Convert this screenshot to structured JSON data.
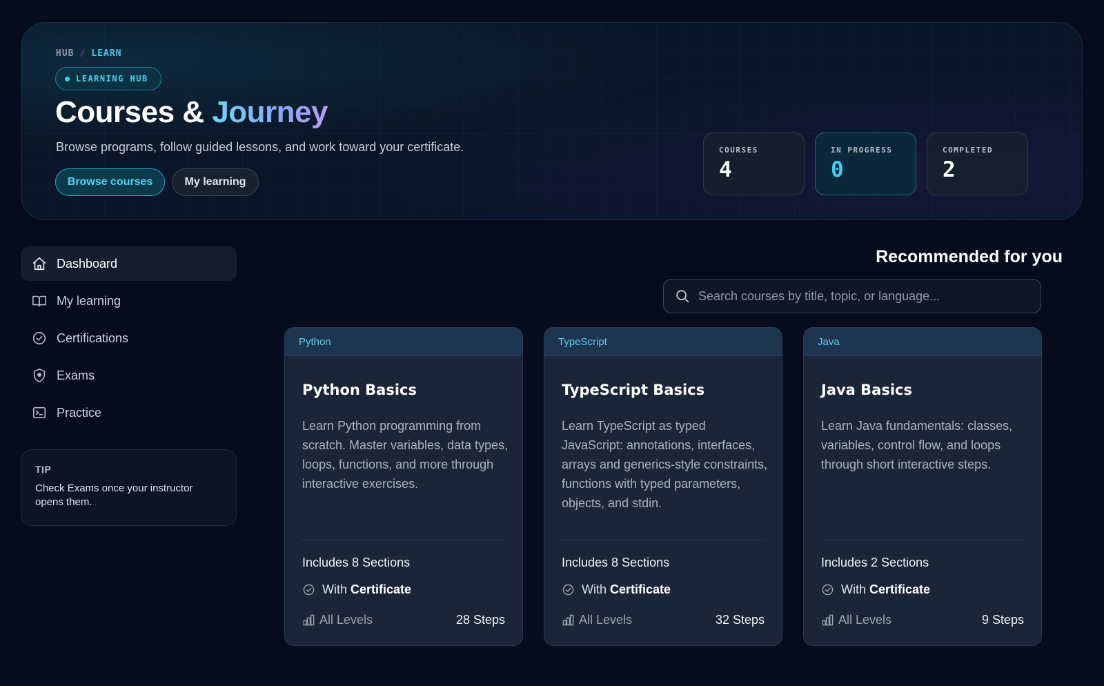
{
  "hero": {
    "breadcrumb": [
      "HUB",
      "LEARN"
    ],
    "badge": "LEARNING HUB",
    "title_main": "Courses &",
    "title_accent": "Journey",
    "subtitle": "Browse programs, follow guided lessons, and work toward your certificate.",
    "primary_button": "Browse courses",
    "secondary_button": "My learning",
    "stats": [
      {
        "label": "COURSES",
        "value": "4"
      },
      {
        "label": "IN PROGRESS",
        "value": "0"
      },
      {
        "label": "COMPLETED",
        "value": "2"
      }
    ]
  },
  "sidebar": {
    "items": [
      {
        "label": "Dashboard",
        "icon": "home-icon",
        "active": true
      },
      {
        "label": "My learning",
        "icon": "book-icon",
        "active": false
      },
      {
        "label": "Certifications",
        "icon": "check-circle-icon",
        "active": false
      },
      {
        "label": "Exams",
        "icon": "exam-shield-icon",
        "active": false
      },
      {
        "label": "Practice",
        "icon": "terminal-icon",
        "active": false
      }
    ],
    "tip": {
      "title": "TIP",
      "body": "Check Exams once your instructor opens them."
    }
  },
  "main": {
    "section_title": "Recommended for you",
    "search": {
      "placeholder": "Search courses by title, topic, or language...",
      "value": ""
    },
    "courses": [
      {
        "language": "Python",
        "title": "Python Basics",
        "description": "Learn Python programming from scratch. Master variables, data types, loops, functions, and more through interactive exercises.",
        "sections": "Includes 8 Sections",
        "cert_prefix": "With",
        "cert_label": "Certificate",
        "levels": "All Levels",
        "steps": "28 Steps"
      },
      {
        "language": "TypeScript",
        "title": "TypeScript Basics",
        "description": "Learn TypeScript as typed JavaScript: annotations, interfaces, arrays and generics-style constraints, functions with typed parameters, objects, and stdin.",
        "sections": "Includes 8 Sections",
        "cert_prefix": "With",
        "cert_label": "Certificate",
        "levels": "All Levels",
        "steps": "32 Steps"
      },
      {
        "language": "Java",
        "title": "Java Basics",
        "description": "Learn Java fundamentals: classes, variables, control flow, and loops through short interactive steps.",
        "sections": "Includes 2 Sections",
        "cert_prefix": "With",
        "cert_label": "Certificate",
        "levels": "All Levels",
        "steps": "9 Steps"
      }
    ]
  },
  "colors": {
    "background": "#060b1e",
    "accent": "#45c8ec",
    "card": "#1b2538",
    "card_header": "#1e3550"
  }
}
